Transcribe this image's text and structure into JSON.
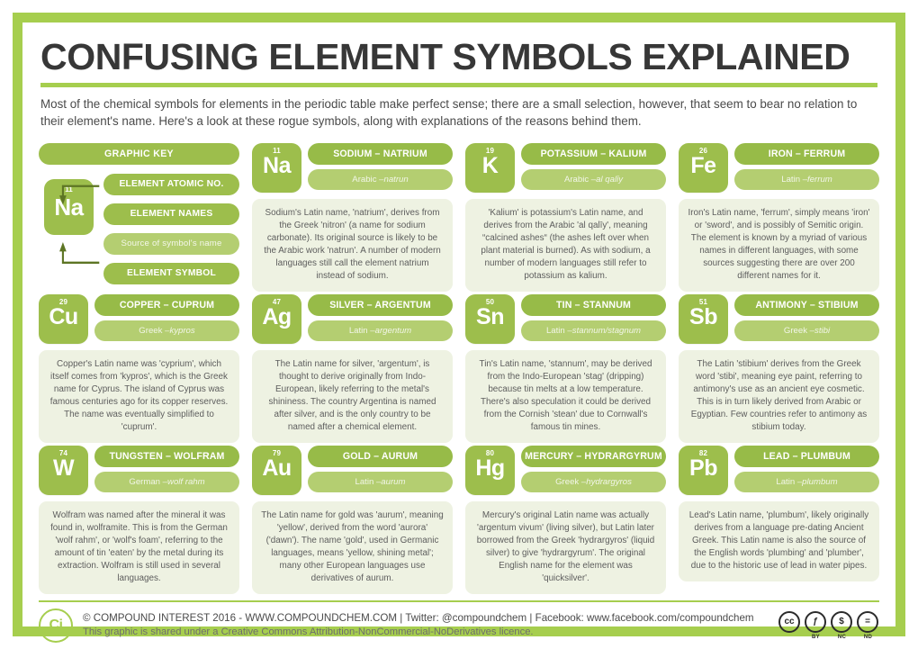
{
  "header": {
    "title": "CONFUSING ELEMENT SYMBOLS EXPLAINED",
    "subtitle": "Most of the chemical symbols for elements in the periodic table make perfect sense; there are a small selection, however, that seem to bear no relation to their element's name. Here's a look at these rogue symbols, along with explanations of the reasons behind them."
  },
  "colors": {
    "border_green": "#a6ce4e",
    "tile_green": "#9dbe4c",
    "title_bar_green": "#97bb48",
    "source_bar_green": "#b4ce71",
    "description_bg": "#eef2e2",
    "title_text": "#373737",
    "body_text": "#5d5d5d"
  },
  "graphic_key": {
    "heading": "GRAPHIC KEY",
    "labels": [
      "ELEMENT ATOMIC NO.",
      "ELEMENT NAMES",
      "Source of symbol's name",
      "ELEMENT SYMBOL"
    ],
    "sample": {
      "atomic_number": "11",
      "symbol": "Na"
    }
  },
  "elements": [
    {
      "atomic_number": "11",
      "symbol": "Na",
      "title": "SODIUM – NATRIUM",
      "source_prefix": "Arabic – ",
      "source_word": "natrun",
      "description": "Sodium's Latin name, 'natrium', derives from the Greek 'nitron' (a name for sodium carbonate). Its original source is likely to be the Arabic work 'natrun'. A number of modern languages still call the element natrium instead of sodium."
    },
    {
      "atomic_number": "19",
      "symbol": "K",
      "title": "POTASSIUM – KALIUM",
      "source_prefix": "Arabic – ",
      "source_word": "al qalīy",
      "description": "'Kalium' is potassium's Latin name, and derives from the Arabic 'al qalīy', meaning “calcined ashes“ (the ashes left over when plant material is burned). As with sodium, a number of modern languages still refer to potassium as kalium."
    },
    {
      "atomic_number": "26",
      "symbol": "Fe",
      "title": "IRON – FERRUM",
      "source_prefix": "Latin – ",
      "source_word": "ferrum",
      "description": "Iron's Latin name, 'ferrum', simply means 'iron' or 'sword', and is possibly of Semitic origin. The element is known by a myriad of various names in different languages, with some sources suggesting there are over 200 different names for it."
    },
    {
      "atomic_number": "29",
      "symbol": "Cu",
      "title": "COPPER – CUPRUM",
      "source_prefix": "Greek – ",
      "source_word": "kypros",
      "description": "Copper's Latin name was 'cyprium', which itself comes from 'kypros', which is the Greek name for Cyprus. The island of Cyprus was famous centuries ago for its copper reserves. The name was eventually simplified to 'cuprum'."
    },
    {
      "atomic_number": "47",
      "symbol": "Ag",
      "title": "SILVER – ARGENTUM",
      "source_prefix": "Latin – ",
      "source_word": "argentum",
      "description": "The Latin name for silver, 'argentum', is thought to derive originally from Indo-European, likely referring to the metal's shininess. The country Argentina is named after silver, and is the only country to be named after a chemical element."
    },
    {
      "atomic_number": "50",
      "symbol": "Sn",
      "title": "TIN – STANNUM",
      "source_prefix": "Latin – ",
      "source_word": "stannum/stagnum",
      "description": "Tin's Latin name, 'stannum', may be derived from the Indo-European 'stag' (dripping) because tin melts at a low temperature. There's also speculation it could be derived from the Cornish 'stean' due to Cornwall's famous tin mines."
    },
    {
      "atomic_number": "51",
      "symbol": "Sb",
      "title": "ANTIMONY – STIBIUM",
      "source_prefix": "Greek – ",
      "source_word": "stibi",
      "description": "The Latin 'stibium' derives from the Greek word 'stibi', meaning eye paint, referring to antimony's use as an ancient eye cosmetic. This is in turn likely derived from Arabic or Egyptian. Few countries refer to antimony as stibium today."
    },
    {
      "atomic_number": "74",
      "symbol": "W",
      "title": "TUNGSTEN – WOLFRAM",
      "source_prefix": "German – ",
      "source_word": "wolf rahm",
      "description": "Wolfram was named after the mineral it was found in, wolframite. This is from the German 'wolf rahm', or 'wolf's foam', referring to the amount of tin 'eaten' by the metal during its extraction. Wolfram is still used in several languages."
    },
    {
      "atomic_number": "79",
      "symbol": "Au",
      "title": "GOLD – AURUM",
      "source_prefix": "Latin – ",
      "source_word": "aurum",
      "description": "The Latin name for gold was 'aurum', meaning 'yellow', derived from the word 'aurora' ('dawn'). The name 'gold', used in Germanic languages, means 'yellow, shining metal'; many other European languages use derivatives of aurum."
    },
    {
      "atomic_number": "80",
      "symbol": "Hg",
      "title": "MERCURY – HYDRARGYRUM",
      "source_prefix": "Greek – ",
      "source_word": "hydrargyros",
      "description": "Mercury's original Latin name was actually 'argentum vivum' (living silver), but Latin later borrowed from the Greek 'hydrargyros' (liquid silver) to give 'hydrargyrum'. The original English name for the element was 'quicksilver'."
    },
    {
      "atomic_number": "82",
      "symbol": "Pb",
      "title": "LEAD – PLUMBUM",
      "source_prefix": "Latin – ",
      "source_word": "plumbum",
      "description": "Lead's Latin name, 'plumbum', likely originally derives from a language pre-dating Ancient Greek. This Latin name is also the source of the English words 'plumbing' and 'plumber', due to the historic use of lead in water pipes."
    }
  ],
  "footer": {
    "logo_text": "Ci",
    "line1": "© COMPOUND INTEREST 2016 - WWW.COMPOUNDCHEM.COM | Twitter: @compoundchem | Facebook: www.facebook.com/compoundchem",
    "line2": "This graphic is shared under a Creative Commons Attribution-NonCommercial-NoDerivatives licence.",
    "cc_icons": [
      {
        "glyph": "cc",
        "label": ""
      },
      {
        "glyph": "ƒ",
        "label": "BY"
      },
      {
        "glyph": "$",
        "label": "NC"
      },
      {
        "glyph": "=",
        "label": "ND"
      }
    ]
  }
}
